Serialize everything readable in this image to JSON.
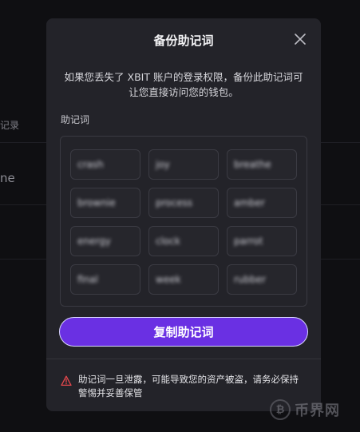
{
  "background": {
    "text_1": "记录",
    "text_2": "ne"
  },
  "modal": {
    "title": "备份助记词",
    "close_icon": "close-icon",
    "description": "如果您丢失了 XBIT 账户的登录权限，备份此助记词可让您直接访问您的钱包。",
    "section_label": "助记词",
    "words": [
      "crash",
      "joy",
      "breathe",
      "brownie",
      "process",
      "amber",
      "energy",
      "clock",
      "parrot",
      "final",
      "week",
      "rubber"
    ],
    "copy_button": "复制助记词",
    "warning_icon": "warning-triangle-icon",
    "warning_text": "助记词一旦泄露，可能导致您的资产被盗，请务必保持警惕并妥善保管"
  },
  "watermark": {
    "logo_letter": "₿",
    "text": "币界网"
  },
  "colors": {
    "accent": "#6a30e3",
    "modal_bg": "#232329",
    "warning": "#e5484d"
  }
}
